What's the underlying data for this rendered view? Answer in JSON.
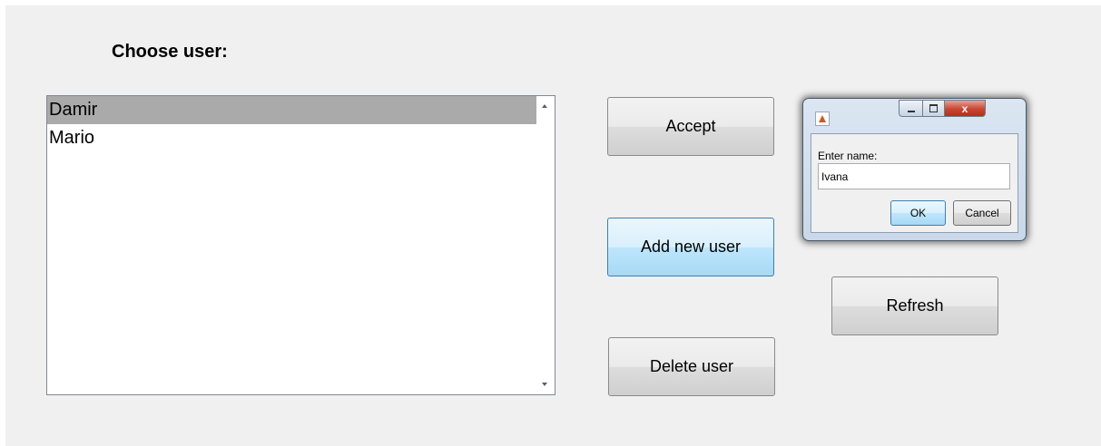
{
  "panel": {
    "title": "Choose user:"
  },
  "user_list": {
    "items": [
      "Damir",
      "Mario"
    ],
    "selected": "Damir"
  },
  "buttons": {
    "accept": "Accept",
    "add_new_user": "Add new user",
    "delete_user": "Delete user",
    "refresh": "Refresh"
  },
  "dialog": {
    "icon": "matlab-icon",
    "minimize_glyph": "",
    "close_glyph": "x",
    "label": "Enter name:",
    "input_value": "Ivana",
    "ok_label": "OK",
    "cancel_label": "Cancel"
  },
  "colors": {
    "panel_bg": "#f0f0f0",
    "selected_item_bg": "#aaaaaa",
    "hover_button": "#bee6fd",
    "close_button": "#c74733"
  }
}
